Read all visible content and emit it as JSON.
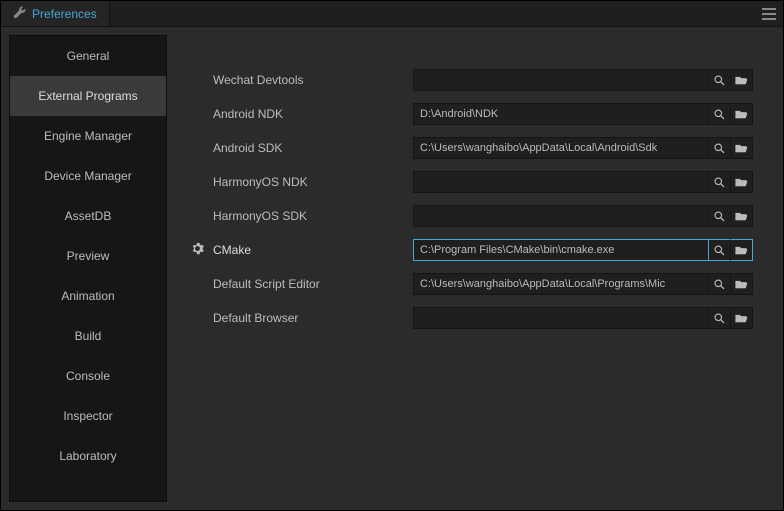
{
  "title": "Preferences",
  "colors": {
    "accent": "#4aa6d6"
  },
  "sidebar": {
    "items": [
      {
        "label": "General"
      },
      {
        "label": "External Programs"
      },
      {
        "label": "Engine Manager"
      },
      {
        "label": "Device Manager"
      },
      {
        "label": "AssetDB"
      },
      {
        "label": "Preview"
      },
      {
        "label": "Animation"
      },
      {
        "label": "Build"
      },
      {
        "label": "Console"
      },
      {
        "label": "Inspector"
      },
      {
        "label": "Laboratory"
      }
    ],
    "active_index": 1
  },
  "fields": [
    {
      "label": "Wechat Devtools",
      "value": "",
      "gear": false,
      "focused": false
    },
    {
      "label": "Android NDK",
      "value": "D:\\Android\\NDK",
      "gear": false,
      "focused": false
    },
    {
      "label": "Android SDK",
      "value": "C:\\Users\\wanghaibo\\AppData\\Local\\Android\\Sdk",
      "gear": false,
      "focused": false
    },
    {
      "label": "HarmonyOS NDK",
      "value": "",
      "gear": false,
      "focused": false
    },
    {
      "label": "HarmonyOS SDK",
      "value": "",
      "gear": false,
      "focused": false
    },
    {
      "label": "CMake",
      "value": "C:\\Program Files\\CMake\\bin\\cmake.exe",
      "gear": true,
      "focused": true
    },
    {
      "label": "Default Script Editor",
      "value": "C:\\Users\\wanghaibo\\AppData\\Local\\Programs\\Mic",
      "gear": false,
      "focused": false
    },
    {
      "label": "Default Browser",
      "value": "",
      "gear": false,
      "focused": false
    }
  ]
}
